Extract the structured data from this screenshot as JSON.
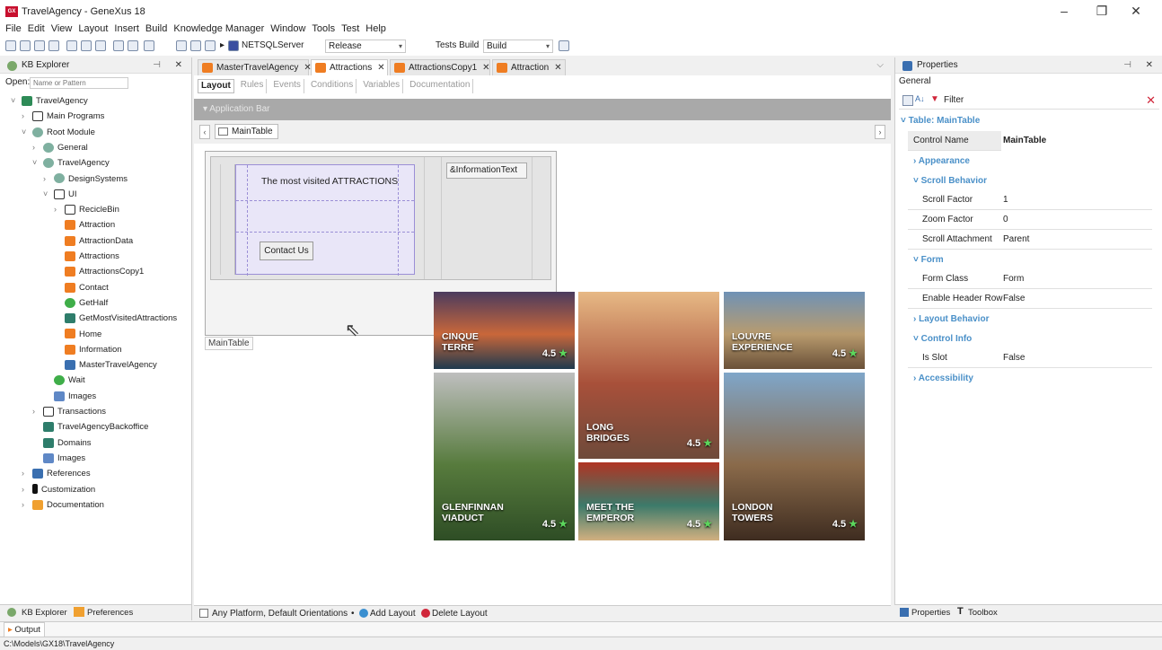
{
  "window": {
    "title": "TravelAgency - GeneXus 18",
    "logo_text": "GX"
  },
  "menu": [
    "File",
    "Edit",
    "View",
    "Layout",
    "Insert",
    "Build",
    "Knowledge Manager",
    "Window",
    "Tools",
    "Test",
    "Help"
  ],
  "toolbar": {
    "environment": "NETSQLServer",
    "configuration": "Release",
    "tests_label": "Tests Build",
    "build": "Build"
  },
  "kb_explorer": {
    "title": "KB Explorer",
    "open_label": "Open:",
    "open_placeholder": "Name or Pattern",
    "tree": [
      {
        "label": "TravelAgency",
        "icon": "kb-icon",
        "depth": 0,
        "chev": "˅"
      },
      {
        "label": "Main Programs",
        "icon": "main-programs-icon",
        "depth": 1,
        "chev": "›"
      },
      {
        "label": "Root Module",
        "icon": "module-icon",
        "depth": 1,
        "chev": "˅"
      },
      {
        "label": "General",
        "icon": "module-icon",
        "depth": 2,
        "chev": "›"
      },
      {
        "label": "TravelAgency",
        "icon": "module-icon",
        "depth": 2,
        "chev": "˅"
      },
      {
        "label": "DesignSystems",
        "icon": "module-icon",
        "depth": 3,
        "chev": "›"
      },
      {
        "label": "UI",
        "icon": "folder-icon",
        "depth": 3,
        "chev": "˅"
      },
      {
        "label": "RecicleBin",
        "icon": "folder-icon",
        "depth": 4,
        "chev": "›"
      },
      {
        "label": "Attraction",
        "icon": "webpanel-icon",
        "depth": 4,
        "chev": ""
      },
      {
        "label": "AttractionData",
        "icon": "data-provider-icon",
        "depth": 4,
        "chev": ""
      },
      {
        "label": "Attractions",
        "icon": "webpanel-icon",
        "depth": 4,
        "chev": ""
      },
      {
        "label": "AttractionsCopy1",
        "icon": "webpanel-icon",
        "depth": 4,
        "chev": ""
      },
      {
        "label": "Contact",
        "icon": "webpanel-icon",
        "depth": 4,
        "chev": ""
      },
      {
        "label": "GetHalf",
        "icon": "procedure-icon",
        "depth": 4,
        "chev": ""
      },
      {
        "label": "GetMostVisitedAttractions",
        "icon": "sdt-icon",
        "depth": 4,
        "chev": ""
      },
      {
        "label": "Home",
        "icon": "webpanel-icon",
        "depth": 4,
        "chev": ""
      },
      {
        "label": "Information",
        "icon": "info-object-icon",
        "depth": 4,
        "chev": ""
      },
      {
        "label": "MasterTravelAgency",
        "icon": "master-page-icon",
        "depth": 4,
        "chev": ""
      },
      {
        "label": "Wait",
        "icon": "procedure-icon",
        "depth": 3,
        "chev": ""
      },
      {
        "label": "Images",
        "icon": "images-icon",
        "depth": 3,
        "chev": ""
      },
      {
        "label": "Transactions",
        "icon": "folder-icon",
        "depth": 2,
        "chev": "›"
      },
      {
        "label": "TravelAgencyBackoffice",
        "icon": "backoffice-icon",
        "depth": 2,
        "chev": ""
      },
      {
        "label": "Domains",
        "icon": "domains-icon",
        "depth": 2,
        "chev": ""
      },
      {
        "label": "Images",
        "icon": "images-icon",
        "depth": 2,
        "chev": ""
      },
      {
        "label": "References",
        "icon": "references-icon",
        "depth": 1,
        "chev": "›"
      },
      {
        "label": "Customization",
        "icon": "customization-icon",
        "depth": 1,
        "chev": "›"
      },
      {
        "label": "Documentation",
        "icon": "documentation-icon",
        "depth": 1,
        "chev": "›"
      }
    ],
    "bottom_tabs": [
      "KB Explorer",
      "Preferences"
    ]
  },
  "editor": {
    "tabs": [
      "MasterTravelAgency",
      "Attractions",
      "AttractionsCopy1",
      "Attraction"
    ],
    "active_tab": "Attractions",
    "subtabs": [
      "Layout",
      "Rules",
      "Events",
      "Conditions",
      "Variables",
      "Documentation"
    ],
    "app_bar": "Application Bar",
    "table_label": "MainTable",
    "text_block": "The most visited ATTRACTIONS",
    "button": "Contact Us",
    "info_var": "&InformationText",
    "table_name_tag": "MainTable",
    "platform_text": "Any Platform, Default Orientations",
    "add_layout": "Add Layout",
    "delete_layout": "Delete Layout"
  },
  "gallery": [
    {
      "name": "CINQUE\nTERRE",
      "rating": "4.5",
      "colors": [
        "#4b3b5e",
        "#c9673a",
        "#1f3a4e"
      ]
    },
    {
      "name": "LONG\nBRIDGES",
      "rating": "4.5",
      "colors": [
        "#e7b985",
        "#a8503a",
        "#6e4a3a"
      ]
    },
    {
      "name": "LOUVRE\nEXPERIENCE",
      "rating": "4.5",
      "colors": [
        "#6f92b6",
        "#b89b6e",
        "#6a5038"
      ]
    },
    {
      "name": "GLENFINNAN\nVIADUCT",
      "rating": "4.5",
      "colors": [
        "#bfbfbf",
        "#577b3d",
        "#2e4d25"
      ]
    },
    {
      "name": "MEET THE\nEMPEROR",
      "rating": "4.5",
      "colors": [
        "#b03423",
        "#3c7a6a",
        "#d2b080"
      ]
    },
    {
      "name": "LONDON\nTOWERS",
      "rating": "4.5",
      "colors": [
        "#7fa6c9",
        "#8a6a4a",
        "#3e2c20"
      ]
    }
  ],
  "gallery_star": "★",
  "properties": {
    "title": "Properties",
    "tab": "General",
    "filter": "Filter",
    "object": "Table: MainTable",
    "control_name_label": "Control Name",
    "control_name_value": "MainTable",
    "sections": {
      "appearance": "Appearance",
      "scroll": "Scroll Behavior",
      "form": "Form",
      "layout": "Layout Behavior",
      "control": "Control Info",
      "access": "Accessibility"
    },
    "rows": {
      "scroll_factor": [
        "Scroll Factor",
        "1"
      ],
      "zoom_factor": [
        "Zoom Factor",
        "0"
      ],
      "scroll_attachment": [
        "Scroll Attachment",
        "Parent"
      ],
      "form_class": [
        "Form Class",
        "Form"
      ],
      "enable_header": [
        "Enable Header Row",
        "False"
      ],
      "is_slot": [
        "Is Slot",
        "False"
      ]
    },
    "bottom_tabs": [
      "Properties",
      "Toolbox"
    ]
  },
  "output_tab": "Output",
  "status_path": "C:\\Models\\GX18\\TravelAgency"
}
